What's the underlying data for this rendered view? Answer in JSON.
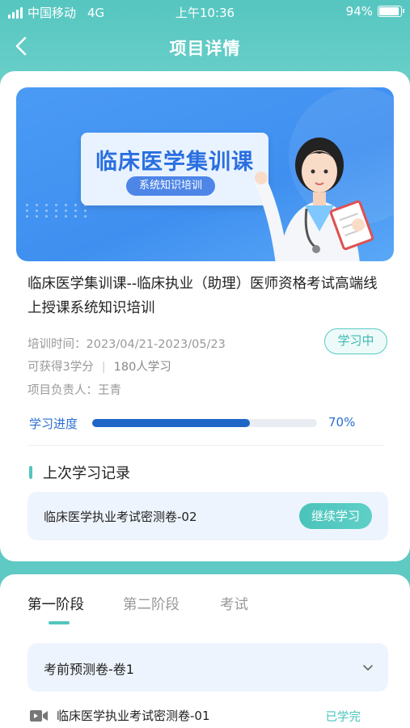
{
  "status_bar": {
    "carrier": "中国移动",
    "network": "4G",
    "time": "上午10:36",
    "battery": "94%",
    "battery_level": 0.94
  },
  "nav": {
    "title": "项目详情",
    "back_icon": "chevron-left-icon"
  },
  "banner": {
    "headline": "临床医学集训课",
    "subtitle": "系统知识培训",
    "colors": {
      "primary": "#3f8ff0",
      "accent": "#2a6fe0"
    }
  },
  "project": {
    "title": "临床医学集训课--临床执业（助理）医师资格考试高端线上授课系统知识培训",
    "training_time": "培训时间：2023/04/21-2023/05/23",
    "credits": "可获得3学分",
    "learners": "180人学习",
    "manager": "项目负责人：王青",
    "status_badge": "学习中",
    "progress_label": "学习进度",
    "progress_value": "70%",
    "progress_fraction": 0.7
  },
  "last_record": {
    "heading": "上次学习记录",
    "item": "临床医学执业考试密测卷-02",
    "continue_label": "继续学习"
  },
  "stages": {
    "tabs": [
      {
        "label": "第一阶段",
        "active": true
      },
      {
        "label": "第二阶段",
        "active": false
      },
      {
        "label": "考试",
        "active": false
      }
    ],
    "group": {
      "title": "考前预测卷-卷1",
      "icon": "chevron-down-icon"
    },
    "items": [
      {
        "title": "临床医学执业考试密测卷-01",
        "status": "已学完",
        "icon": "video-icon"
      }
    ]
  },
  "colors": {
    "teal": "#53c5be",
    "blue": "#1f66c7"
  }
}
